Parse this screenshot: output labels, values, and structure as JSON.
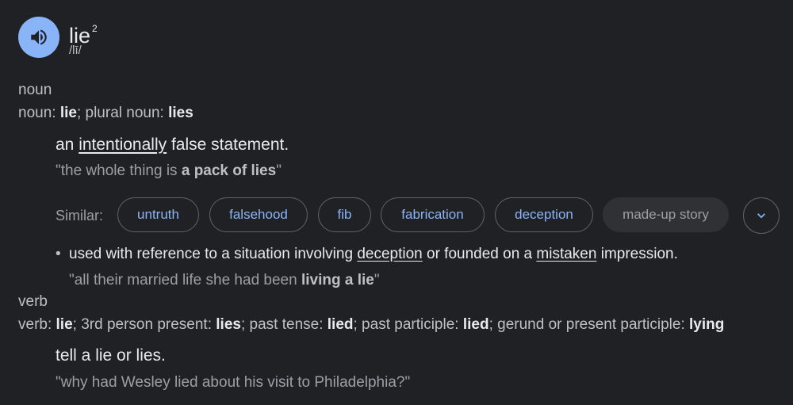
{
  "entry": {
    "word": "lie",
    "superscript": "2",
    "pronunciation": "/lī/",
    "speaker_icon": "speaker-icon"
  },
  "noun": {
    "pos": "noun",
    "forms": {
      "label1": "noun: ",
      "word1": "lie",
      "sep": "; plural noun: ",
      "word2": "lies"
    },
    "definition": {
      "pre": "an ",
      "link": "intentionally",
      "post": " false statement."
    },
    "example": {
      "pre": "\"the whole thing is ",
      "bold": "a pack of lies",
      "post": "\""
    },
    "similar_label": "Similar:",
    "similar": [
      "untruth",
      "falsehood",
      "fib",
      "fabrication",
      "deception",
      "made-up story"
    ],
    "sub_sense": {
      "bullet": "•",
      "pre": "used with reference to a situation involving ",
      "link1": "deception",
      "mid": " or founded on a ",
      "link2": "mistaken",
      "post": " impression."
    },
    "sub_example": {
      "pre": "\"all their married life she had been ",
      "bold": "living a lie",
      "post": "\""
    }
  },
  "verb": {
    "pos": "verb",
    "forms": {
      "l1": "verb: ",
      "w1": "lie",
      "l2": "; 3rd person present: ",
      "w2": "lies",
      "l3": "; past tense: ",
      "w3": "lied",
      "l4": "; past participle: ",
      "w4": "lied",
      "l5": "; gerund or present participle: ",
      "w5": "lying"
    },
    "definition": "tell a lie or lies.",
    "example": "\"why had Wesley lied about his visit to Philadelphia?\""
  },
  "colors": {
    "background": "#202124",
    "accent": "#8ab4f8",
    "text_primary": "#e8eaed",
    "text_secondary": "#bdc1c6",
    "text_muted": "#9aa0a6"
  }
}
